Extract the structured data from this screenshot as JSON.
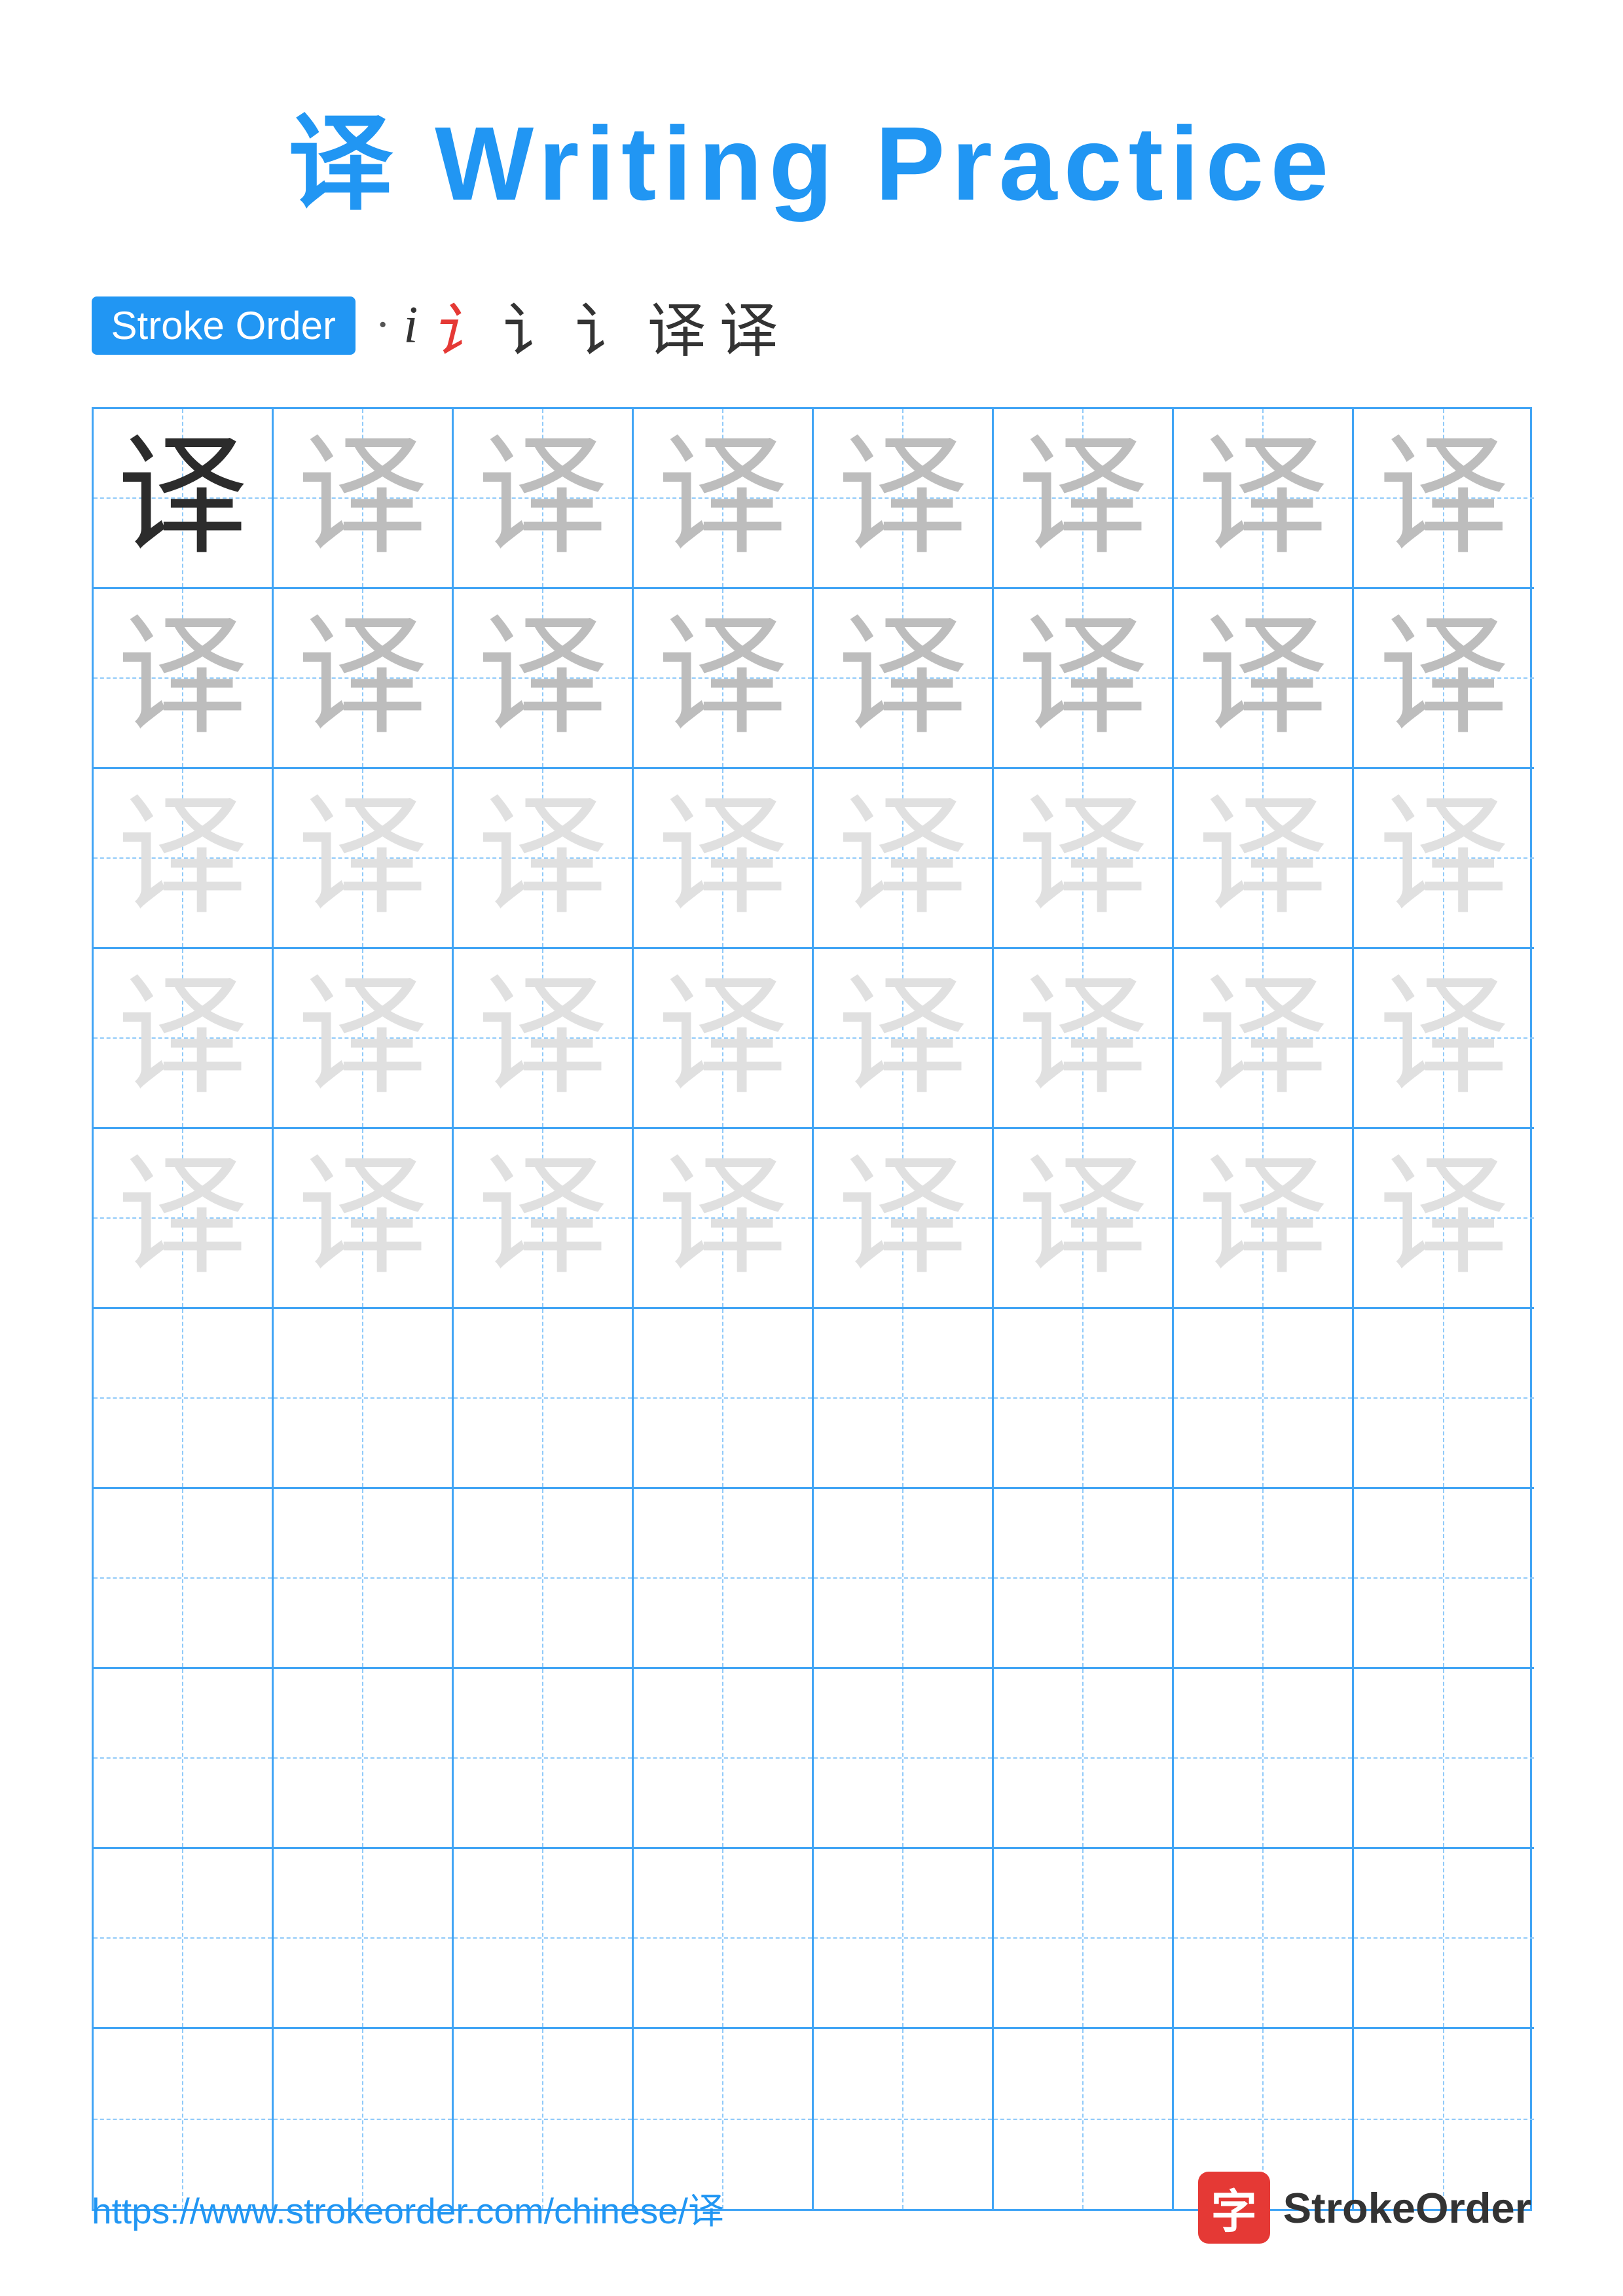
{
  "title": "译 Writing Practice",
  "stroke_order": {
    "badge_label": "Stroke Order",
    "sequence": [
      "·",
      "i",
      "i̇",
      "讠",
      "讠",
      "译",
      "译"
    ]
  },
  "grid": {
    "rows": 10,
    "cols": 8,
    "character": "译",
    "rows_data": [
      {
        "cells": [
          "dark",
          "medium",
          "medium",
          "medium",
          "medium",
          "medium",
          "medium",
          "medium"
        ]
      },
      {
        "cells": [
          "medium",
          "medium",
          "medium",
          "medium",
          "medium",
          "medium",
          "medium",
          "medium"
        ]
      },
      {
        "cells": [
          "light",
          "light",
          "light",
          "light",
          "light",
          "light",
          "light",
          "light"
        ]
      },
      {
        "cells": [
          "light",
          "light",
          "light",
          "light",
          "light",
          "light",
          "light",
          "light"
        ]
      },
      {
        "cells": [
          "light",
          "light",
          "light",
          "light",
          "light",
          "light",
          "light",
          "light"
        ]
      },
      {
        "cells": [
          "empty",
          "empty",
          "empty",
          "empty",
          "empty",
          "empty",
          "empty",
          "empty"
        ]
      },
      {
        "cells": [
          "empty",
          "empty",
          "empty",
          "empty",
          "empty",
          "empty",
          "empty",
          "empty"
        ]
      },
      {
        "cells": [
          "empty",
          "empty",
          "empty",
          "empty",
          "empty",
          "empty",
          "empty",
          "empty"
        ]
      },
      {
        "cells": [
          "empty",
          "empty",
          "empty",
          "empty",
          "empty",
          "empty",
          "empty",
          "empty"
        ]
      },
      {
        "cells": [
          "empty",
          "empty",
          "empty",
          "empty",
          "empty",
          "empty",
          "empty",
          "empty"
        ]
      }
    ]
  },
  "footer": {
    "url": "https://www.strokeorder.com/chinese/译",
    "logo_char": "字",
    "logo_text": "StrokeOrder"
  }
}
